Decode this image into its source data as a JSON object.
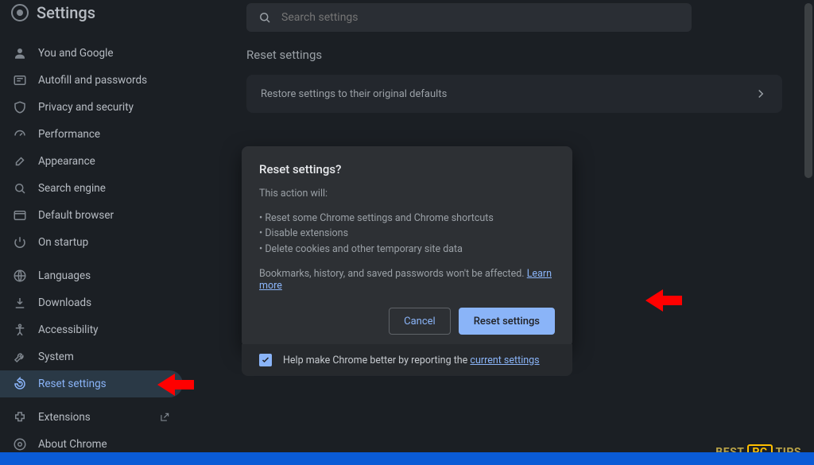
{
  "brand": {
    "title": "Settings"
  },
  "search": {
    "placeholder": "Search settings"
  },
  "sidebar": {
    "group1": [
      {
        "icon": "person-icon",
        "label": "You and Google"
      },
      {
        "icon": "autofill-icon",
        "label": "Autofill and passwords"
      },
      {
        "icon": "shield-icon",
        "label": "Privacy and security"
      },
      {
        "icon": "speedometer-icon",
        "label": "Performance"
      },
      {
        "icon": "brush-icon",
        "label": "Appearance"
      },
      {
        "icon": "search-icon",
        "label": "Search engine"
      },
      {
        "icon": "window-icon",
        "label": "Default browser"
      },
      {
        "icon": "power-icon",
        "label": "On startup"
      }
    ],
    "group2": [
      {
        "icon": "globe-icon",
        "label": "Languages"
      },
      {
        "icon": "download-icon",
        "label": "Downloads"
      },
      {
        "icon": "accessibility-icon",
        "label": "Accessibility"
      },
      {
        "icon": "wrench-icon",
        "label": "System"
      },
      {
        "icon": "restore-icon",
        "label": "Reset settings",
        "selected": true
      }
    ],
    "group3": [
      {
        "icon": "puzzle-icon",
        "label": "Extensions",
        "external": true
      },
      {
        "icon": "chrome-icon",
        "label": "About Chrome"
      }
    ]
  },
  "section": {
    "heading": "Reset settings",
    "row_label": "Restore settings to their original defaults"
  },
  "modal": {
    "title": "Reset settings?",
    "lead": "This action will:",
    "bullets": [
      "Reset some Chrome settings and Chrome shortcuts",
      "Disable extensions",
      "Delete cookies and other temporary site data"
    ],
    "footnote_text": "Bookmarks, history, and saved passwords won't be affected.",
    "learn_more": "Learn more",
    "cancel": "Cancel",
    "confirm": "Reset settings",
    "checkbox_text_prefix": "Help make Chrome better by reporting the ",
    "checkbox_link": "current settings"
  },
  "watermark": {
    "best": "BEST",
    "pc": "PC",
    "tips": "TIPS"
  }
}
